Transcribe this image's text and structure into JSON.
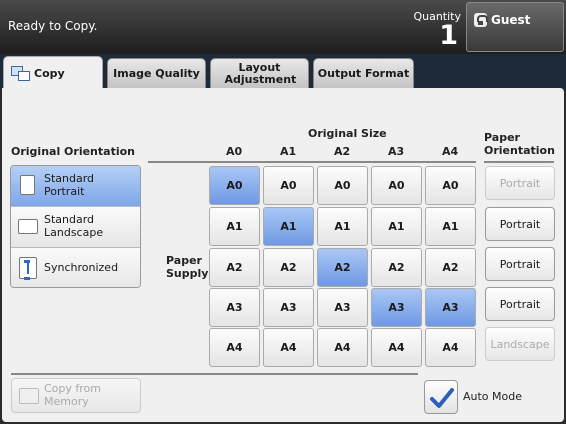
{
  "header": {
    "status": "Ready to Copy.",
    "quantity_label": "Quantity",
    "quantity_value": "1",
    "user": "Guest"
  },
  "tabs": [
    "Copy",
    "Image Quality",
    "Layout Adjustment",
    "Output Format"
  ],
  "original_orientation": {
    "label": "Original Orientation",
    "options": [
      "Standard Portrait",
      "Standard Landscape",
      "Synchronized"
    ],
    "selected": "Standard Portrait"
  },
  "original_size": {
    "label": "Original Size",
    "columns": [
      "A0",
      "A1",
      "A2",
      "A3",
      "A4"
    ]
  },
  "paper_supply": {
    "label": "Paper Supply",
    "rows": [
      "A0",
      "A1",
      "A2",
      "A3",
      "A4"
    ]
  },
  "grid_selected": [
    {
      "original": "A0",
      "paper": "A0"
    },
    {
      "original": "A1",
      "paper": "A1"
    },
    {
      "original": "A2",
      "paper": "A2"
    },
    {
      "original": "A3",
      "paper": "A3"
    },
    {
      "original": "A4",
      "paper": "A3"
    }
  ],
  "paper_orientation": {
    "label": "Paper Orientation",
    "buttons": [
      {
        "label": "Portrait",
        "enabled": false
      },
      {
        "label": "Portrait",
        "enabled": true
      },
      {
        "label": "Portrait",
        "enabled": true
      },
      {
        "label": "Portrait",
        "enabled": true
      },
      {
        "label": "Landscape",
        "enabled": false
      }
    ]
  },
  "copy_from_memory": "Copy from Memory",
  "auto_mode": {
    "label": "Auto Mode",
    "checked": true
  }
}
